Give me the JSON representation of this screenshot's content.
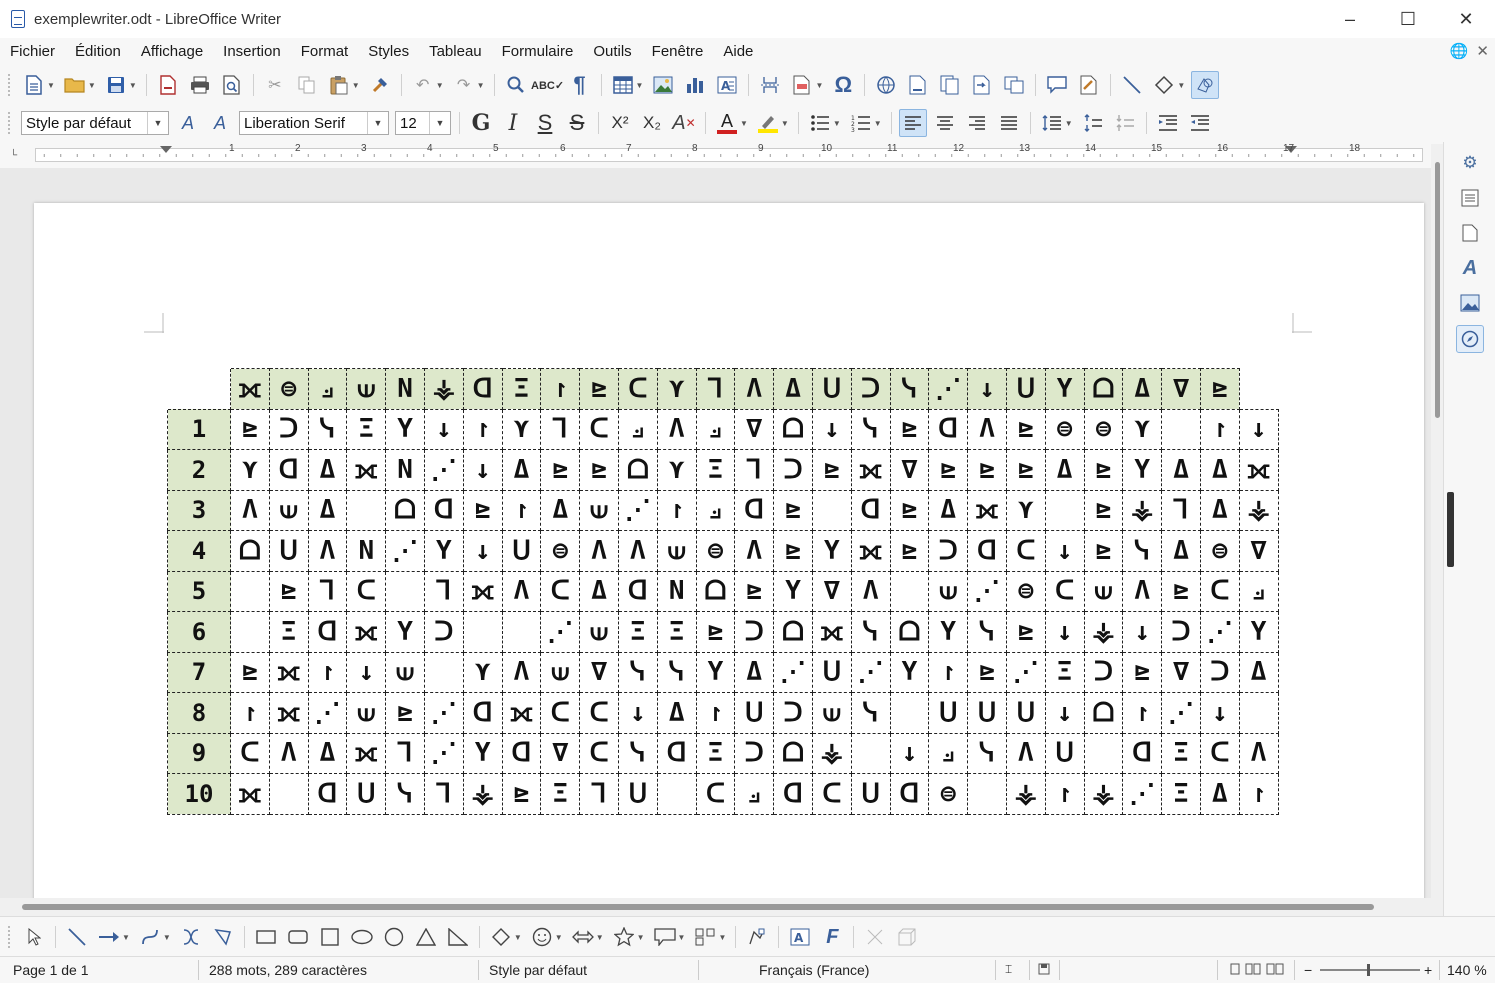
{
  "window": {
    "title": "exemplewriter.odt - LibreOffice Writer",
    "minimize": "–",
    "maximize": "☐",
    "close": "✕"
  },
  "menu": [
    "Fichier",
    "Édition",
    "Affichage",
    "Insertion",
    "Format",
    "Styles",
    "Tableau",
    "Formulaire",
    "Outils",
    "Fenêtre",
    "Aide"
  ],
  "menu_right": {
    "globe": "🌐",
    "close": "✕"
  },
  "formatting": {
    "paragraph_style": "Style par défaut",
    "font_name": "Liberation Serif",
    "font_size": "12"
  },
  "toolbar2_glyphs": {
    "bold": "G",
    "italic": "I",
    "underline": "S",
    "strike": "S",
    "superscript": "X²",
    "subscript": "X₂",
    "font_color": "A"
  },
  "ruler": {
    "numbers": [
      "1",
      "2",
      "3",
      "4",
      "5",
      "6",
      "7",
      "8",
      "9",
      "10",
      "11",
      "12",
      "13",
      "14",
      "15",
      "16",
      "17",
      "18"
    ]
  },
  "table": {
    "header": [
      "⟗",
      "⊜",
      "⟓",
      "⟒",
      "Ν",
      "⚶",
      "ᗡ",
      "Ξ",
      "↾",
      "⊵",
      "ᑕ",
      "⋎",
      "⅂",
      "Λ",
      "Δ",
      "ᑌ",
      "ᑐ",
      "ᓭ",
      "⋰",
      "↓",
      "ᑌ",
      "Υ",
      "ᗝ",
      "Δ",
      "∇",
      "⊵"
    ],
    "rows": [
      {
        "label": "1",
        "cells": [
          "⊵",
          "ᑐ",
          "ᓭ",
          "Ξ",
          "Υ",
          "↓",
          "↾",
          "⋎",
          "⅂",
          "ᑕ",
          "⟓",
          "Λ",
          "⟓",
          "∇",
          "ᗝ",
          "↓",
          "ᓭ",
          "⊵",
          "ᗡ",
          "Λ",
          "⊵",
          "⊜",
          "⊜",
          "⋎",
          "",
          "↾",
          "↓"
        ]
      },
      {
        "label": "2",
        "cells": [
          "⋎",
          "ᗡ",
          "Δ",
          "⟗",
          "Ν",
          "⋰",
          "↓",
          "Δ",
          "⊵",
          "⊵",
          "ᗝ",
          "⋎",
          "Ξ",
          "⅂",
          "ᑐ",
          "⊵",
          "⟗",
          "∇",
          "⊵",
          "⊵",
          "⊵",
          "Δ",
          "⊵",
          "Υ",
          "Δ",
          "Δ",
          "⟗"
        ]
      },
      {
        "label": "3",
        "cells": [
          "Λ",
          "⟒",
          "Δ",
          "",
          "ᗝ",
          "ᗡ",
          "⊵",
          "↾",
          "Δ",
          "⟒",
          "⋰",
          "↾",
          "⟓",
          "ᗡ",
          "⊵",
          "",
          "ᗡ",
          "⊵",
          "Δ",
          "⟗",
          "⋎",
          "",
          "⊵",
          "⚶",
          "⅂",
          "Δ",
          "⚶"
        ]
      },
      {
        "label": "4",
        "cells": [
          "ᗝ",
          "ᑌ",
          "Λ",
          "Ν",
          "⋰",
          "Υ",
          "↓",
          "ᑌ",
          "⊜",
          "Λ",
          "Λ",
          "⟒",
          "⊜",
          "Λ",
          "⊵",
          "Υ",
          "⟗",
          "⊵",
          "ᑐ",
          "ᗡ",
          "ᑕ",
          "↓",
          "⊵",
          "ᓭ",
          "Δ",
          "⊜",
          "∇"
        ]
      },
      {
        "label": "5",
        "cells": [
          "",
          "⊵",
          "⅂",
          "ᑕ",
          "",
          "⅂",
          "⟗",
          "Λ",
          "ᑕ",
          "Δ",
          "ᗡ",
          "Ν",
          "ᗝ",
          "⊵",
          "Υ",
          "∇",
          "Λ",
          "",
          "⟒",
          "⋰",
          "⊜",
          "ᑕ",
          "⟒",
          "Λ",
          "⊵",
          "ᑕ",
          "⟓"
        ]
      },
      {
        "label": "6",
        "cells": [
          "",
          "Ξ",
          "ᗡ",
          "⟗",
          "Υ",
          "ᑐ",
          "",
          "",
          "⋰",
          "⟒",
          "Ξ",
          "Ξ",
          "⊵",
          "ᑐ",
          "ᗝ",
          "⟗",
          "ᓭ",
          "ᗝ",
          "Υ",
          "ᓭ",
          "⊵",
          "↓",
          "⚶",
          "↓",
          "ᑐ",
          "⋰",
          "Υ"
        ]
      },
      {
        "label": "7",
        "cells": [
          "⊵",
          "⟗",
          "↾",
          "↓",
          "⟒",
          "",
          "⋎",
          "Λ",
          "⟒",
          "∇",
          "ᓭ",
          "ᓭ",
          "Υ",
          "Δ",
          "⋰",
          "ᑌ",
          "⋰",
          "Υ",
          "↾",
          "⊵",
          "⋰",
          "Ξ",
          "ᑐ",
          "⊵",
          "∇",
          "ᑐ",
          "Δ"
        ]
      },
      {
        "label": "8",
        "cells": [
          "↾",
          "⟗",
          "⋰",
          "⟒",
          "⊵",
          "⋰",
          "ᗡ",
          "⟗",
          "ᑕ",
          "ᑕ",
          "↓",
          "Δ",
          "↾",
          "ᑌ",
          "ᑐ",
          "⟒",
          "ᓭ",
          "",
          "ᑌ",
          "ᑌ",
          "ᑌ",
          "↓",
          "ᗝ",
          "↾",
          "⋰",
          "↓",
          ""
        ]
      },
      {
        "label": "9",
        "cells": [
          "ᑕ",
          "Λ",
          "Δ",
          "⟗",
          "⅂",
          "⋰",
          "Υ",
          "ᗡ",
          "∇",
          "ᑕ",
          "ᓭ",
          "ᗡ",
          "Ξ",
          "ᑐ",
          "ᗝ",
          "⚶",
          "",
          "↓",
          "⟓",
          "ᓭ",
          "Λ",
          "ᑌ",
          "",
          "ᗡ",
          "Ξ",
          "ᑕ",
          "Λ"
        ]
      },
      {
        "label": "10",
        "cells": [
          "⟗",
          "",
          "ᗡ",
          "ᑌ",
          "ᓭ",
          "⅂",
          "⚶",
          "⊵",
          "Ξ",
          "⅂",
          "ᑌ",
          "",
          "ᑕ",
          "⟓",
          "ᗡ",
          "ᑕ",
          "ᑌ",
          "ᗡ",
          "⊜",
          "",
          "⚶",
          "↾",
          "⚶",
          "⋰",
          "Ξ",
          "Δ",
          "↾"
        ]
      }
    ]
  },
  "status": {
    "page": "Page 1 de 1",
    "words": "288 mots, 289 caractères",
    "style": "Style par défaut",
    "language": "Français (France)",
    "zoom_minus": "−",
    "zoom_plus": "+",
    "zoom": "140 %"
  }
}
